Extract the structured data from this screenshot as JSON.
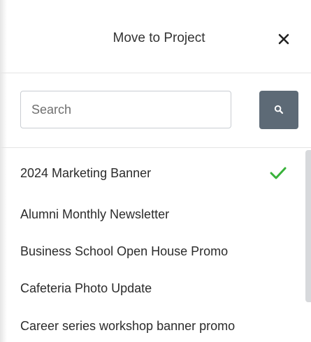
{
  "dialog": {
    "title": "Move to Project",
    "close_icon": "close-icon"
  },
  "search": {
    "placeholder": "Search",
    "value": "",
    "button_icon": "search-icon"
  },
  "projects": [
    {
      "name": "2024 Marketing Banner",
      "selected": true
    },
    {
      "name": "Alumni Monthly Newsletter",
      "selected": false
    },
    {
      "name": "Business School Open House Promo",
      "selected": false
    },
    {
      "name": "Cafeteria Photo Update",
      "selected": false
    },
    {
      "name": "Career series workshop banner promo",
      "selected": false
    }
  ],
  "colors": {
    "check": "#38b23a",
    "search_button": "#5d6a76",
    "divider": "#e4e4e4"
  }
}
